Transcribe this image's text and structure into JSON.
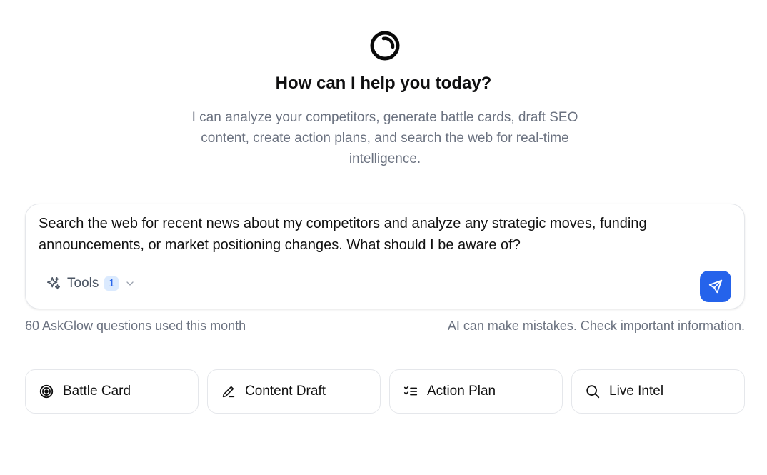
{
  "hero": {
    "logo_icon": "ring-logo-icon",
    "title": "How can I help you today?",
    "subtitle": "I can analyze your competitors, generate battle cards, draft SEO content, create action plans, and search the web for real-time intelligence."
  },
  "composer": {
    "value": "Search the web for recent news about my competitors and analyze any strategic moves, funding announcements, or market positioning changes. What should I be aware of?",
    "tools_label": "Tools",
    "tools_count": "1",
    "tools_icon": "sparkles-icon",
    "dropdown_icon": "chevron-down-icon",
    "send_icon": "send-icon",
    "accent_color": "#2563eb"
  },
  "footer": {
    "usage": "60 AskGlow questions used this month",
    "disclaimer": "AI can make mistakes. Check important information."
  },
  "quick_actions": [
    {
      "label": "Battle Card",
      "icon": "target-icon"
    },
    {
      "label": "Content Draft",
      "icon": "pen-icon"
    },
    {
      "label": "Action Plan",
      "icon": "checklist-icon"
    },
    {
      "label": "Live Intel",
      "icon": "search-icon"
    }
  ]
}
